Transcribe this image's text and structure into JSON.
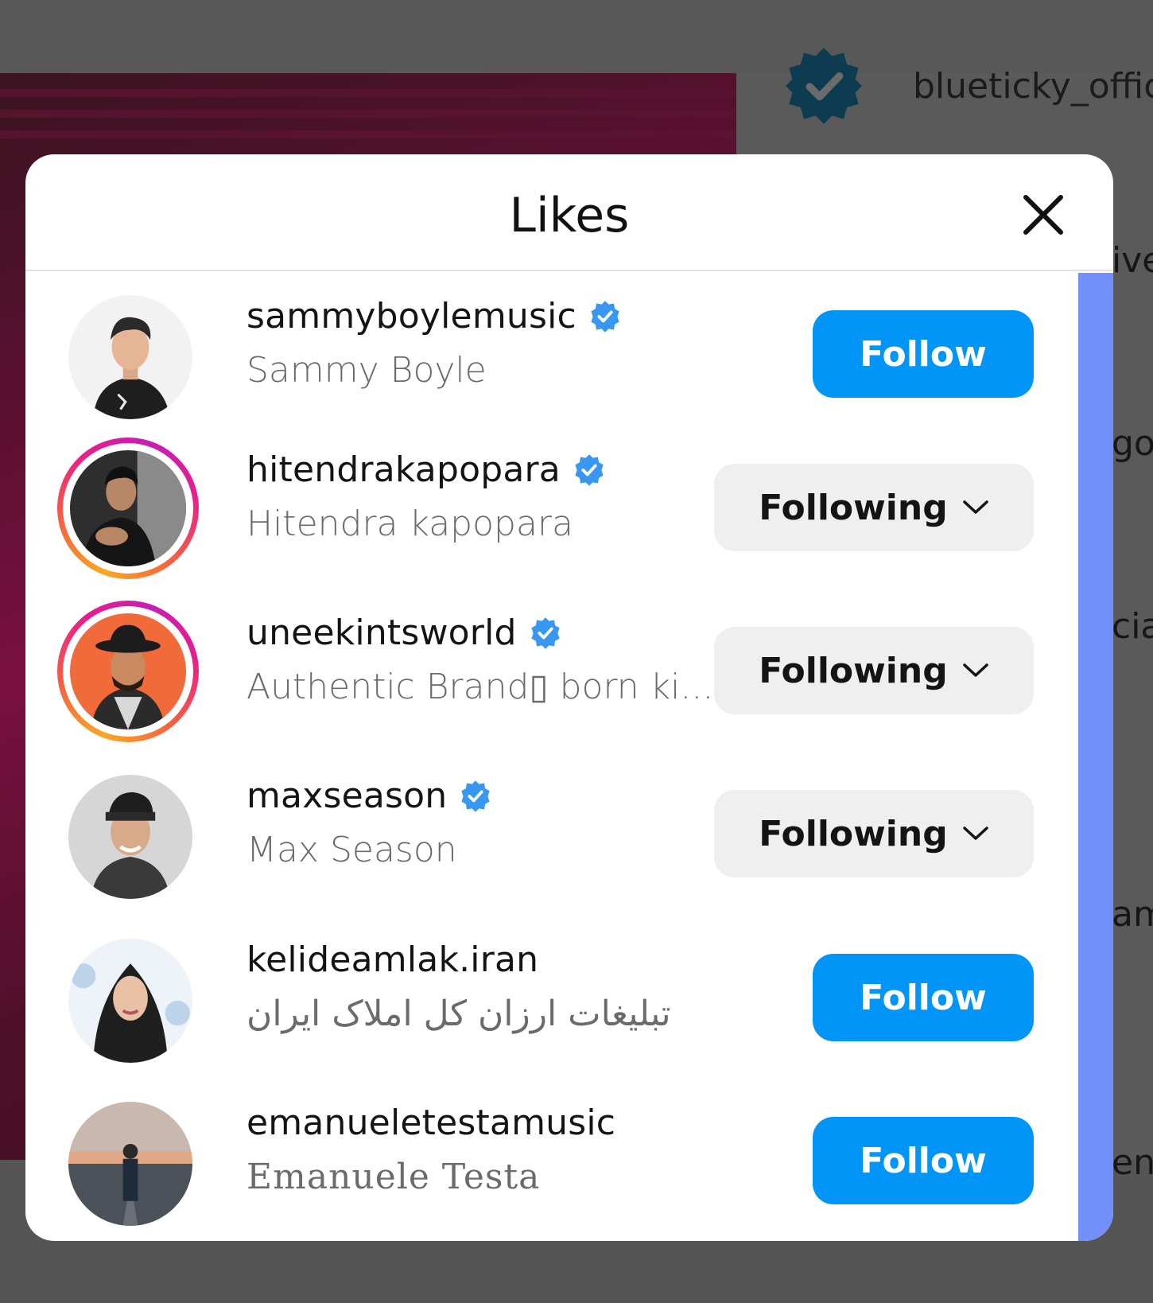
{
  "background": {
    "account_name": "blueticky_offic",
    "side_snippets": [
      "ive",
      "go",
      "cial",
      "am",
      "ent"
    ]
  },
  "modal": {
    "title": "Likes",
    "close_icon": "close-icon",
    "users": [
      {
        "username": "sammyboylemusic",
        "verified": true,
        "fullname": "Sammy Boyle",
        "story_ring": false,
        "action": "Follow"
      },
      {
        "username": "hitendrakapopara",
        "verified": true,
        "fullname": "Hitendra kapopara",
        "story_ring": true,
        "action": "Following"
      },
      {
        "username": "uneekintsworld",
        "verified": true,
        "fullname": "Authentic Brand▯ born ki...",
        "story_ring": true,
        "action": "Following"
      },
      {
        "username": "maxseason",
        "verified": true,
        "fullname": "Max Season",
        "story_ring": false,
        "action": "Following"
      },
      {
        "username": "kelideamlak.iran",
        "verified": false,
        "fullname": "تبلیغات ارزان کل املاک ایران",
        "story_ring": false,
        "action": "Follow"
      },
      {
        "username": "emanueletestamusic",
        "verified": false,
        "fullname": "Emanuele Testa",
        "story_ring": false,
        "action": "Follow"
      }
    ]
  },
  "colors": {
    "follow_blue": "#0095f6",
    "following_gray": "#efefef",
    "verified_blue": "#3897f0",
    "scrollbar": "#7190fb"
  }
}
